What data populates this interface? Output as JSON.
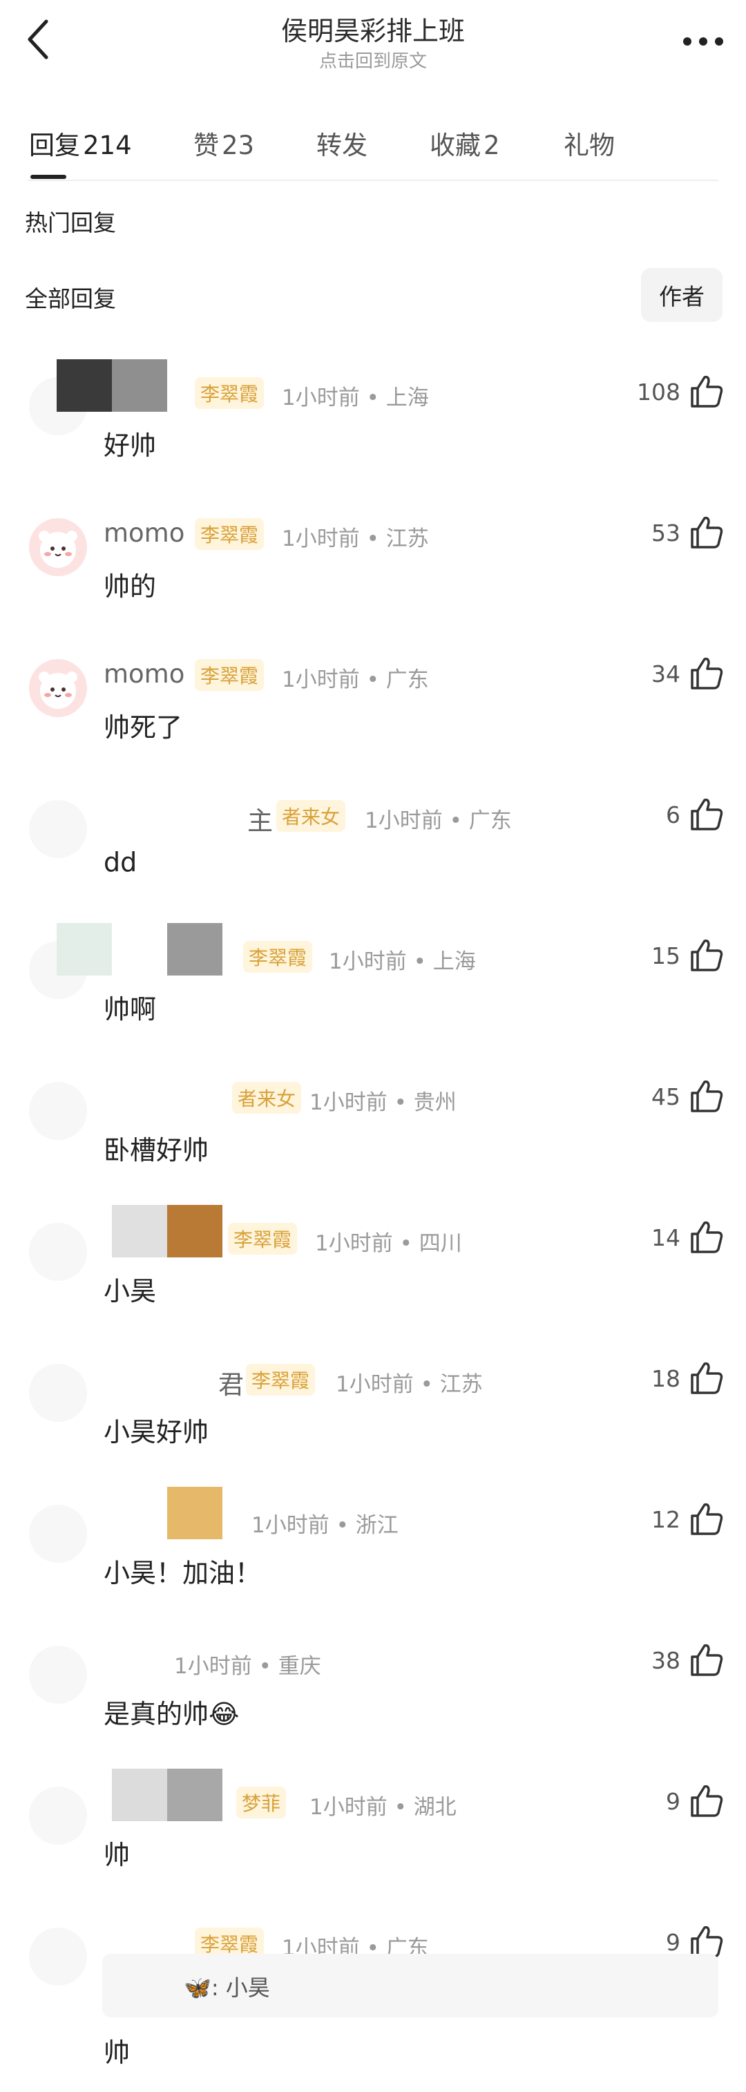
{
  "header": {
    "title": "侯明昊彩排上班",
    "subtitle": "点击回到原文"
  },
  "tabs": [
    {
      "label": "回复",
      "count": "214"
    },
    {
      "label": "赞",
      "count": "23"
    },
    {
      "label": "转发",
      "count": ""
    },
    {
      "label": "收藏",
      "count": "2"
    },
    {
      "label": "礼物",
      "count": ""
    }
  ],
  "sections": {
    "hot": "热门回复",
    "all": "全部回复",
    "author_filter": "作者"
  },
  "comments": [
    {
      "username": "",
      "badge": "李翠霞",
      "time": "1小时前",
      "location": "上海",
      "likes": "108",
      "text": "好帅"
    },
    {
      "username": "momo",
      "badge": "李翠霞",
      "time": "1小时前",
      "location": "江苏",
      "likes": "53",
      "text": "帅的"
    },
    {
      "username": "momo",
      "badge": "李翠霞",
      "time": "1小时前",
      "location": "广东",
      "likes": "34",
      "text": "帅死了"
    },
    {
      "username": "主",
      "badge": "者来女",
      "time": "1小时前",
      "location": "广东",
      "likes": "6",
      "text": "dd"
    },
    {
      "username": "",
      "badge": "李翠霞",
      "time": "1小时前",
      "location": "上海",
      "likes": "15",
      "text": "帅啊"
    },
    {
      "username": "",
      "badge": "者来女",
      "time": "1小时前",
      "location": "贵州",
      "likes": "45",
      "text": "卧槽好帅"
    },
    {
      "username": "",
      "badge": "李翠霞",
      "time": "1小时前",
      "location": "四川",
      "likes": "14",
      "text": "小昊"
    },
    {
      "username": "君",
      "badge": "李翠霞",
      "time": "1小时前",
      "location": "江苏",
      "likes": "18",
      "text": "小昊好帅"
    },
    {
      "username": "",
      "badge": "",
      "time": "1小时前",
      "location": "浙江",
      "likes": "12",
      "text": "小昊！加油！"
    },
    {
      "username": "",
      "badge": "",
      "time": "1小时前",
      "location": "重庆",
      "likes": "38",
      "text": "是真的帅😂"
    },
    {
      "username": "",
      "badge": "梦菲",
      "time": "1小时前",
      "location": "湖北",
      "likes": "9",
      "text": "帅"
    },
    {
      "username": "",
      "badge": "李翠霞",
      "time": "1小时前",
      "location": "广东",
      "likes": "9",
      "text": "帅",
      "quote": "🦋: 小昊"
    }
  ],
  "colors": {
    "badge_bg": "#fff4dc",
    "badge_text": "#d8a23a",
    "meta_text": "#9a9a9a"
  },
  "icons": [
    "back-arrow-icon",
    "more-dots-icon",
    "thumbs-up-icon"
  ]
}
